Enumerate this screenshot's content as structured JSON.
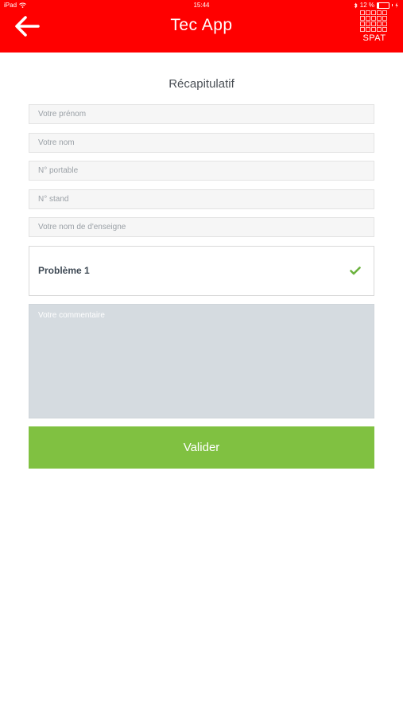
{
  "status_bar": {
    "device": "iPad",
    "time": "15:44",
    "battery_text": "12 %",
    "battery_level": 0.12,
    "icons": [
      "wifi-icon",
      "bluetooth-icon",
      "battery-icon",
      "charging-icon"
    ]
  },
  "header": {
    "title": "Tec App",
    "logo_text": "SPAT",
    "back_icon": "arrow-left-icon",
    "color": "#ff0000"
  },
  "form": {
    "heading": "Récapitulatif",
    "fields": [
      {
        "placeholder": "Votre prénom",
        "value": ""
      },
      {
        "placeholder": "Votre nom",
        "value": ""
      },
      {
        "placeholder": "N° portable",
        "value": ""
      },
      {
        "placeholder": "N° stand",
        "value": ""
      },
      {
        "placeholder": "Votre nom de d'enseigne",
        "value": ""
      }
    ],
    "problem": {
      "label": "Problème 1",
      "selected": true,
      "icon": "checkmark-icon",
      "check_color": "#6cb33f"
    },
    "comment": {
      "placeholder": "Votre commentaire",
      "value": ""
    },
    "submit_label": "Valider",
    "submit_color": "#80c141"
  }
}
